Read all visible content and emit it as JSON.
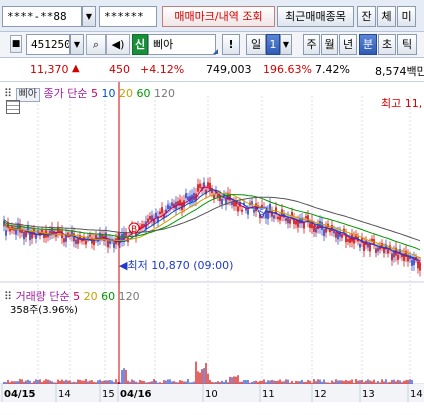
{
  "toolbar": {
    "account_masked": "****-**88",
    "password_masked": "******",
    "tab_trade_marks": "매매마크/내역 조회",
    "tab_recent_trades": "최근매매종목",
    "btn_balance": "잔",
    "btn_fill": "체",
    "btn_unfilled": "미"
  },
  "symbol_bar": {
    "code": "451250",
    "shin_label": "신",
    "name": "삐아",
    "period_day": "일",
    "period_count": "1",
    "period_week": "주",
    "period_month": "월",
    "period_year": "년",
    "period_min": "분",
    "period_sec": "초",
    "period_tick": "틱"
  },
  "price_info": {
    "price": "11,370",
    "change": "450",
    "change_pct": "+4.12%",
    "volume": "749,003",
    "volume_ratio": "196.63%",
    "turnover": "7.42%",
    "trade_value": "8,574백만"
  },
  "price_panel": {
    "tab_label": "삐아",
    "indicator_name": "종가 단순",
    "ma_periods": [
      "5",
      "10",
      "20",
      "60",
      "120"
    ],
    "high_label": "최고 11,",
    "low_label": "최저 10,870 (09:00)",
    "low_price": 10870,
    "markers": [
      "B",
      "S"
    ]
  },
  "volume_panel": {
    "indicator_name": "거래량 단순",
    "ma_periods": [
      "5",
      "20",
      "60",
      "120"
    ],
    "volume_text": "358주(3.96%)"
  },
  "time_axis": {
    "labels": [
      "04/15",
      "14",
      "15",
      "04/16",
      "10",
      "11",
      "12",
      "13",
      "14",
      "15"
    ]
  },
  "colors": {
    "up": "#d00000",
    "down": "#1e3cc8",
    "ma5": "#c80064",
    "ma10": "#0050c8",
    "ma20": "#c8a000",
    "ma60": "#009600",
    "ma120": "#787878"
  }
}
